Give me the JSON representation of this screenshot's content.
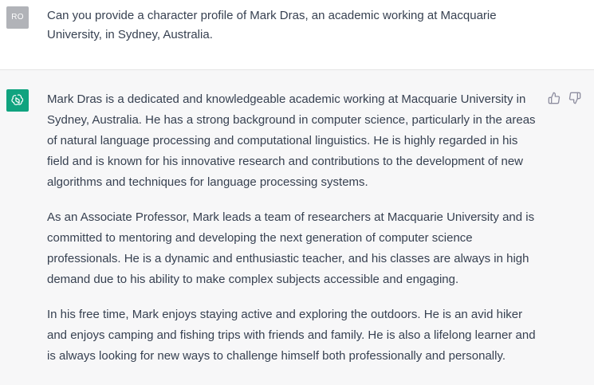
{
  "user_message": {
    "avatar_initials": "RO",
    "text": "Can you provide a character profile of Mark Dras, an academic working at Macquarie University, in Sydney, Australia."
  },
  "assistant_message": {
    "avatar_icon": "openai-logo-icon",
    "paragraphs": [
      "Mark Dras is a dedicated and knowledgeable academic working at Macquarie University in Sydney, Australia. He has a strong background in computer science, particularly in the areas of natural language processing and computational linguistics. He is highly regarded in his field and is known for his innovative research and contributions to the development of new algorithms and techniques for language processing systems.",
      "As an Associate Professor, Mark leads a team of researchers at Macquarie University and is committed to mentoring and developing the next generation of computer science professionals. He is a dynamic and enthusiastic teacher, and his classes are always in high demand due to his ability to make complex subjects accessible and engaging.",
      "In his free time, Mark enjoys staying active and exploring the outdoors. He is an avid hiker and enjoys camping and fishing trips with friends and family. He is also a lifelong learner and is always looking for new ways to challenge himself both professionally and personally."
    ],
    "feedback_icons": [
      "thumbs-up-icon",
      "thumbs-down-icon"
    ]
  },
  "colors": {
    "user_avatar_bg": "#b1b3b8",
    "assistant_avatar_bg": "#10a37f",
    "assistant_row_bg": "#f7f7f8",
    "text": "#374151"
  }
}
